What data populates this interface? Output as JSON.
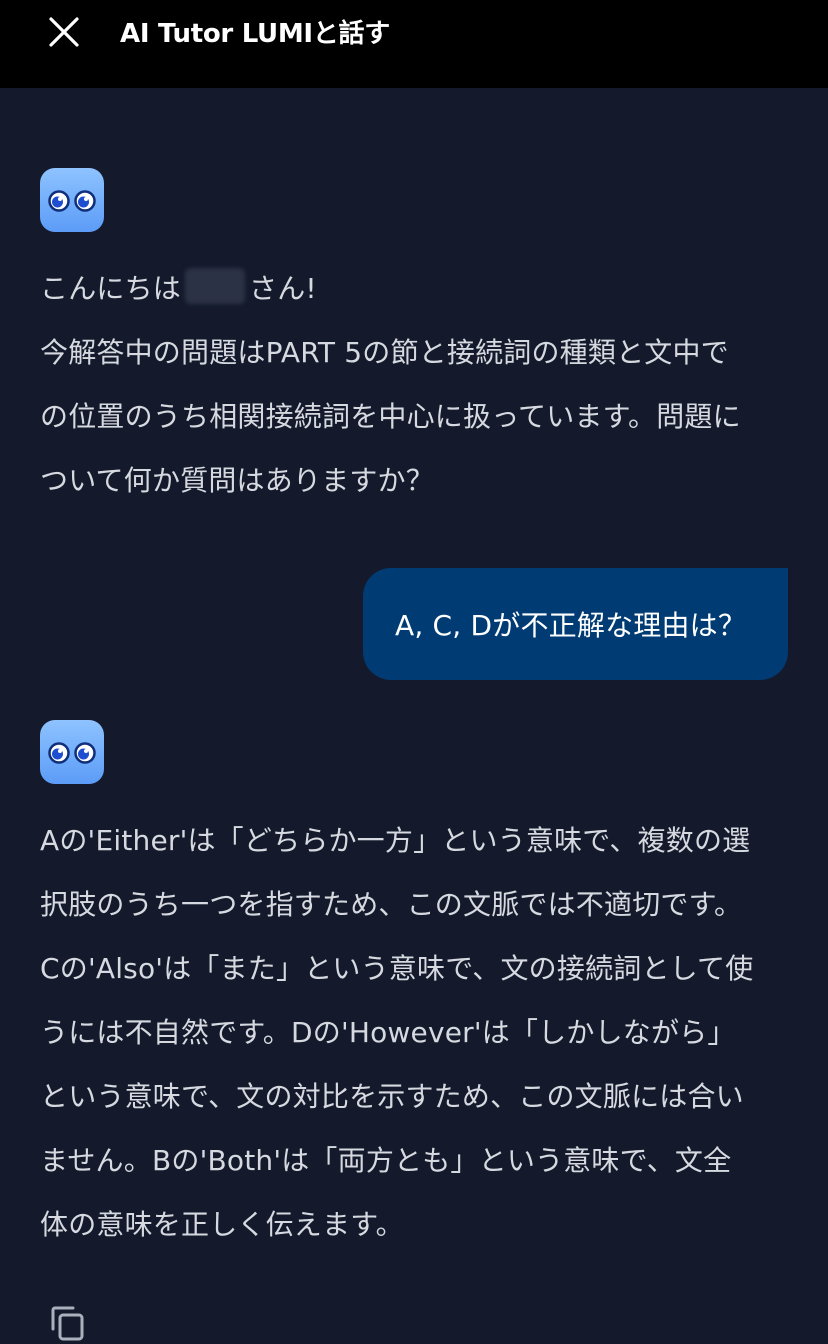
{
  "header": {
    "title": "AI Tutor LUMIと話す",
    "close_icon": "close-icon"
  },
  "messages": [
    {
      "role": "assistant",
      "avatar_icon": "lumi-avatar-icon",
      "greeting_before_name": "こんにちは",
      "greeting_after_name": "さん!",
      "lines": [
        "今解答中の問題はPART 5の節と接続詞の種類と文中で",
        "の位置のうち相関接続詞を中心に扱っています。問題に",
        "ついて何か質問はありますか？"
      ]
    },
    {
      "role": "user",
      "text": "A, C, Dが不正解な理由は？"
    },
    {
      "role": "assistant",
      "avatar_icon": "lumi-avatar-icon",
      "lines": [
        "Aの'Either'は「どちらか一方」という意味で、複数の選",
        "択肢のうち一つを指すため、この文脈では不適切です。",
        "Cの'Also'は「また」という意味で、文の接続詞として使",
        "うには不自然です。Dの'However'は「しかしながら」",
        "という意味で、文の対比を示すため、この文脈には合い",
        "ません。Bの'Both'は「両方とも」という意味で、文全",
        "体の意味を正しく伝えます。"
      ],
      "action_icon": "copy-icon"
    }
  ],
  "colors": {
    "background": "#141a2c",
    "header": "#000000",
    "user_bubble": "#013b73",
    "avatar": "#6fa9fa",
    "text": "#d6d9df"
  }
}
